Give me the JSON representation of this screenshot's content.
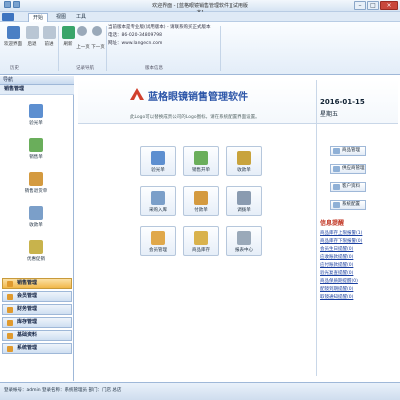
{
  "window": {
    "title": "欢迎界面 - [蓝格眼镜销售管理软件][试用版本]"
  },
  "menu": {
    "tabs": [
      "开始",
      "视图",
      "工具"
    ]
  },
  "ribbon": {
    "buttons": [
      "欢迎界面",
      "后退",
      "前进",
      "刷新",
      "上一页",
      "下一页"
    ],
    "groups": [
      "历史",
      "记录导航",
      "版本信息"
    ],
    "info": [
      "当前版本是专业版(试用版本) - 请联系购买正式版本",
      "电话：86-020-34809798",
      "网址：www.langecn.com"
    ]
  },
  "sidebar": {
    "header": "导航",
    "section": "销售管理",
    "items": [
      "验光单",
      "销售单",
      "销售退货单",
      "收款单",
      "优惠促销"
    ],
    "modules": [
      "销售管理",
      "会员管理",
      "财务管理",
      "库存管理",
      "基础资料",
      "系统管理"
    ]
  },
  "main": {
    "brand": "蓝格眼镜销售管理软件",
    "tip": "此Logo可以替换成贵公司的Logo图标，请在系统配置界面设置。",
    "date": "2016-01-15",
    "weekday": "星期五",
    "tiles": [
      "验光单",
      "销售开单",
      "收款单",
      "采购入库",
      "付款单",
      "调拨单",
      "会员管理",
      "商品库存",
      "报表中心"
    ]
  },
  "quick": [
    "商品管理",
    "供应商管理",
    "客户资料",
    "系统配置"
  ],
  "messages": {
    "title": "信息提醒",
    "items": [
      "商品库存上限报警(1)",
      "商品库存下限报警(0)",
      "会员生日提醒(0)",
      "应收账款提醒(0)",
      "应付账款提醒(0)",
      "验光复查提醒(0)",
      "商品保质期提醒(0)",
      "配镜到期提醒(0)",
      "取镜通知提醒(0)"
    ]
  },
  "status": {
    "text": "登录帐号：admin  登录名称：系统管理员  部门：门店  总店"
  },
  "colors": {
    "brand": "#2c55a8",
    "accent": "#f1b84a",
    "messageTitle": "#c0321f"
  }
}
